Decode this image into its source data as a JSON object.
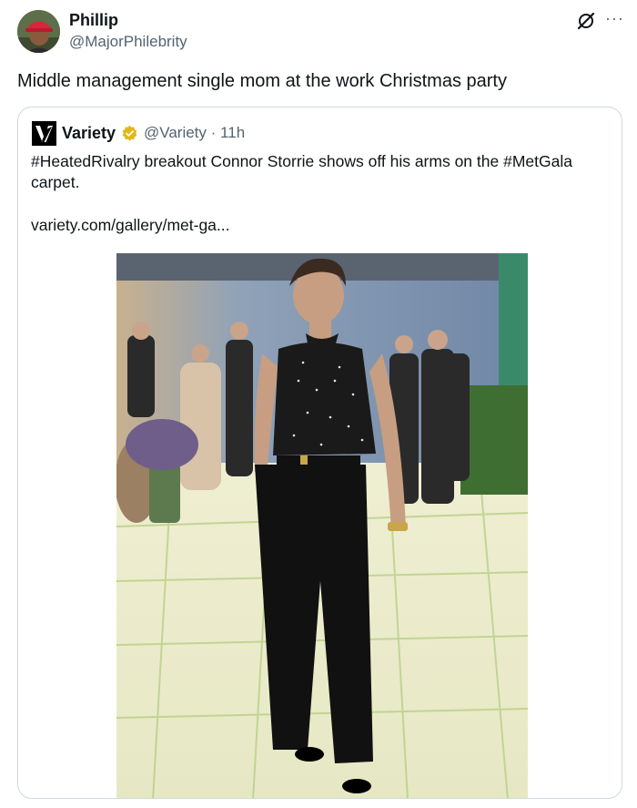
{
  "tweet": {
    "author": {
      "name": "Phillip",
      "handle": "@MajorPhilebrity"
    },
    "text": "Middle management single mom at the work Christmas party"
  },
  "quote": {
    "author": {
      "name": "Variety",
      "handle": "@Variety",
      "time": "11h"
    },
    "separator": "·",
    "text": "#HeatedRivalry breakout Connor Storrie shows off his arms on the #MetGala carpet.",
    "link": "variety.com/gallery/met-ga..."
  },
  "icons": {
    "grok": "grok-icon",
    "more": "more-icon",
    "verified": "verified-badge-icon",
    "logo": "variety-logo-icon"
  },
  "colors": {
    "secondary_text": "#536471",
    "gold_badge": "#e2b719",
    "border": "#cfd9de"
  }
}
